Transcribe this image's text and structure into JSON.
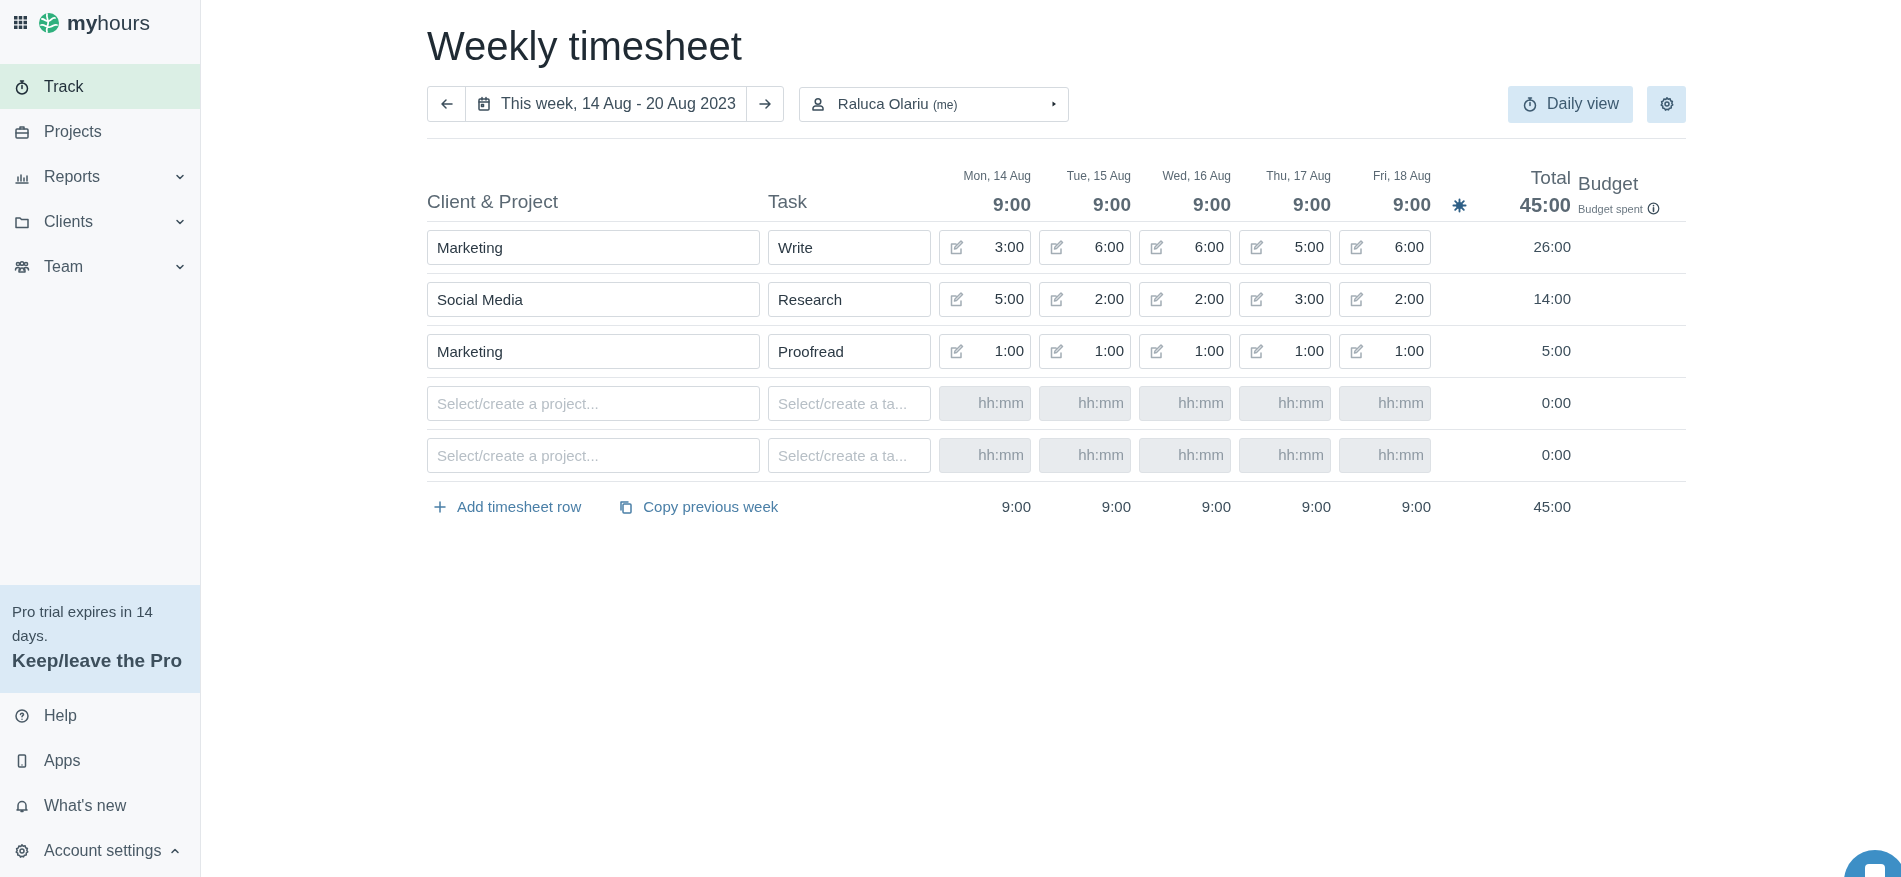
{
  "sidebar": {
    "logo": "**my**hours",
    "nav": [
      {
        "label": "Track",
        "selected": true,
        "kind": "link"
      },
      {
        "label": "Projects",
        "selected": false,
        "kind": "link"
      },
      {
        "label": "Reports",
        "selected": false,
        "kind": "group",
        "expanded": false
      },
      {
        "label": "Clients",
        "selected": false,
        "kind": "group",
        "expanded": false
      },
      {
        "label": "Team",
        "selected": false,
        "kind": "group",
        "expanded": false
      }
    ],
    "trial": {
      "text": "Pro trial expires in 14 days.",
      "action": "Keep/leave the Pro"
    },
    "footer": [
      {
        "label": "Help",
        "kind": "link"
      },
      {
        "label": "Apps",
        "kind": "link"
      },
      {
        "label": "What's new",
        "kind": "link"
      },
      {
        "label": "Account settings",
        "kind": "group",
        "expanded": true
      }
    ]
  },
  "title": "Weekly timesheet",
  "week": "This week, 14 Aug - 20 Aug 2023",
  "user": {
    "name": "Raluca Olariu",
    "suffix": "(me)"
  },
  "daily_view": "Daily view",
  "table": {
    "project_header": "Client & Project",
    "task_header": "Task",
    "days": [
      {
        "date": "Mon, 14 Aug",
        "total": "9:00"
      },
      {
        "date": "Tue, 15 Aug",
        "total": "9:00"
      },
      {
        "date": "Wed, 16 Aug",
        "total": "9:00"
      },
      {
        "date": "Thu, 17 Aug",
        "total": "9:00"
      },
      {
        "date": "Fri, 18 Aug",
        "total": "9:00"
      }
    ],
    "total": {
      "label": "Total",
      "value": "45:00"
    },
    "budget": {
      "label": "Budget",
      "sub": "Budget spent"
    },
    "rows": [
      {
        "project": {
          "value": "Marketing"
        },
        "task": {
          "value": "Write"
        },
        "hours": [
          {
            "value": "3:00",
            "disabled": false
          },
          {
            "value": "6:00",
            "disabled": false
          },
          {
            "value": "6:00",
            "disabled": false
          },
          {
            "value": "5:00",
            "disabled": false
          },
          {
            "value": "6:00",
            "disabled": false
          }
        ],
        "total": "26:00"
      },
      {
        "project": {
          "value": "Social Media"
        },
        "task": {
          "value": "Research"
        },
        "hours": [
          {
            "value": "5:00",
            "disabled": false
          },
          {
            "value": "2:00",
            "disabled": false
          },
          {
            "value": "2:00",
            "disabled": false
          },
          {
            "value": "3:00",
            "disabled": false
          },
          {
            "value": "2:00",
            "disabled": false
          }
        ],
        "total": "14:00"
      },
      {
        "project": {
          "value": "Marketing"
        },
        "task": {
          "value": "Proofread"
        },
        "hours": [
          {
            "value": "1:00",
            "disabled": false
          },
          {
            "value": "1:00",
            "disabled": false
          },
          {
            "value": "1:00",
            "disabled": false
          },
          {
            "value": "1:00",
            "disabled": false
          },
          {
            "value": "1:00",
            "disabled": false
          }
        ],
        "total": "5:00"
      },
      {
        "project": {
          "placeholder": "Select/create a project..."
        },
        "task": {
          "placeholder": "Select/create a ta..."
        },
        "hours": [
          {
            "placeholder": "hh:mm",
            "disabled": true
          },
          {
            "placeholder": "hh:mm",
            "disabled": true
          },
          {
            "placeholder": "hh:mm",
            "disabled": true
          },
          {
            "placeholder": "hh:mm",
            "disabled": true
          },
          {
            "placeholder": "hh:mm",
            "disabled": true
          }
        ],
        "total": "0:00"
      },
      {
        "project": {
          "placeholder": "Select/create a project..."
        },
        "task": {
          "placeholder": "Select/create a ta..."
        },
        "hours": [
          {
            "placeholder": "hh:mm",
            "disabled": true
          },
          {
            "placeholder": "hh:mm",
            "disabled": true
          },
          {
            "placeholder": "hh:mm",
            "disabled": true
          },
          {
            "placeholder": "hh:mm",
            "disabled": true
          },
          {
            "placeholder": "hh:mm",
            "disabled": true
          }
        ],
        "total": "0:00"
      }
    ],
    "footer": {
      "actions": [
        "Add timesheet row",
        "Copy previous week"
      ],
      "totals": [
        "9:00",
        "9:00",
        "9:00",
        "9:00",
        "9:00"
      ],
      "total": "45:00"
    }
  }
}
